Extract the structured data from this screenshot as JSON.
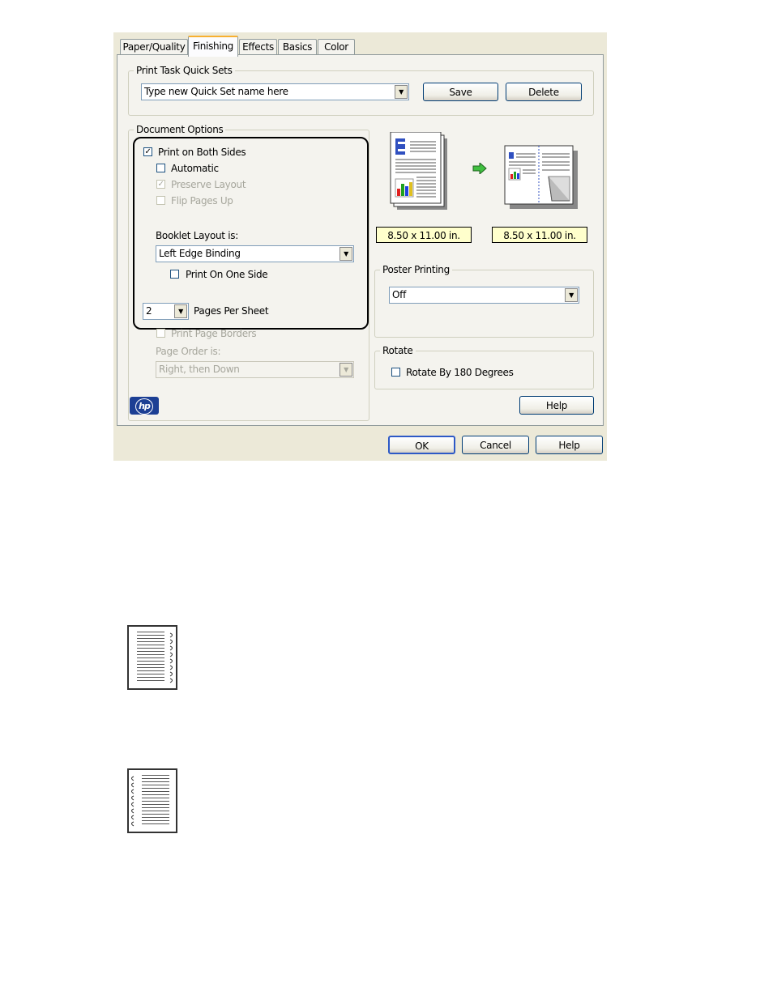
{
  "tabs": [
    "Paper/Quality",
    "Finishing",
    "Effects",
    "Basics",
    "Color"
  ],
  "quick_sets": {
    "label": "Print Task Quick Sets",
    "value": "Type new Quick Set name here",
    "save": "Save",
    "delete": "Delete"
  },
  "document_options": {
    "label": "Document Options",
    "print_both_sides": "Print on Both Sides",
    "automatic": "Automatic",
    "preserve_layout": "Preserve Layout",
    "flip_pages_up": "Flip Pages Up",
    "booklet_label": "Booklet Layout is:",
    "booklet_value": "Left Edge Binding",
    "print_one_side": "Print On One Side",
    "pages_per_sheet_value": "2",
    "pages_per_sheet_label": "Pages Per Sheet",
    "print_page_borders": "Print Page Borders",
    "page_order_label": "Page Order is:",
    "page_order_value": "Right, then Down"
  },
  "preview": {
    "size_left": "8.50 x 11.00 in.",
    "size_right": "8.50 x 11.00 in."
  },
  "poster": {
    "label": "Poster Printing",
    "value": "Off"
  },
  "rotate": {
    "label": "Rotate",
    "option": "Rotate By 180 Degrees"
  },
  "buttons": {
    "help_inner": "Help",
    "ok": "OK",
    "cancel": "Cancel",
    "help": "Help"
  },
  "logo_text": "hp"
}
